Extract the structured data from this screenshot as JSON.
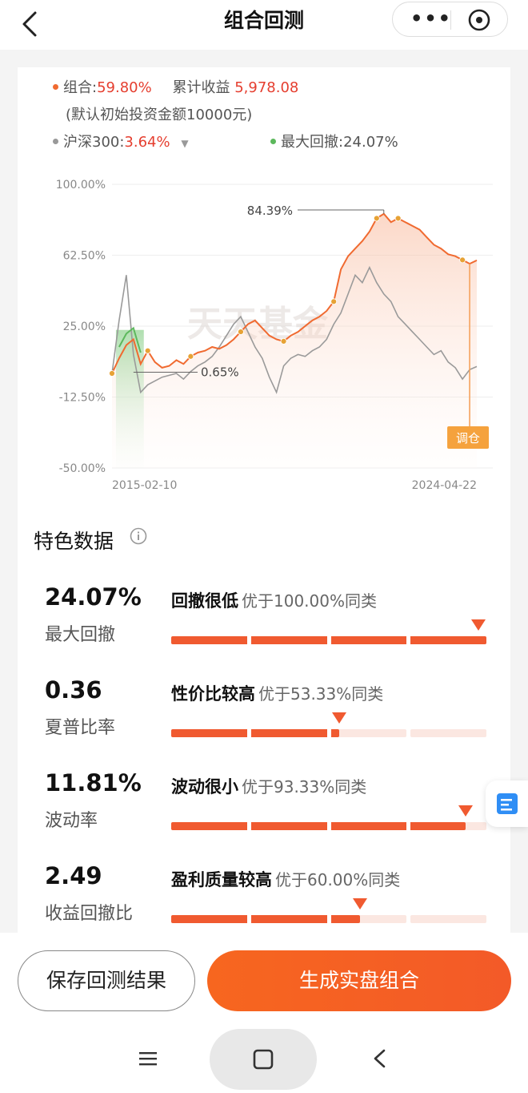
{
  "header": {
    "title": "组合回测",
    "more_icon": "more-dots-icon",
    "close_icon": "close-circle-icon"
  },
  "legend": {
    "portfolio_label": "组合:",
    "portfolio_value": "59.80%",
    "cumulative_label": "累计收益",
    "cumulative_value": "5,978.08",
    "note": "(默认初始投资金额10000元)",
    "benchmark_label": "沪深300:",
    "benchmark_value": "3.64%",
    "drawdown_label": "最大回撤:",
    "drawdown_value": "24.07%"
  },
  "colors": {
    "portfolio": "#f06a30",
    "benchmark": "#999999",
    "drawdown": "#5cb85c",
    "accent": "#f35a28"
  },
  "chart_data": {
    "type": "line",
    "ylim": [
      -50,
      100
    ],
    "yticks": [
      "100.00%",
      "62.50%",
      "25.00%",
      "-12.50%",
      "-50.00%"
    ],
    "x_start": "2015-02-10",
    "x_end": "2024-04-22",
    "annotations": {
      "peak": "84.39%",
      "trough": "0.65%",
      "rebalance": "调仓"
    },
    "watermark": "天天基金",
    "series": [
      {
        "name": "组合",
        "values": [
          0,
          8,
          15,
          18,
          5,
          12,
          6,
          3,
          4,
          7,
          5,
          9,
          11,
          12,
          14,
          13,
          15,
          18,
          22,
          26,
          28,
          24,
          20,
          18,
          17,
          20,
          22,
          25,
          28,
          30,
          33,
          38,
          55,
          62,
          66,
          70,
          75,
          82,
          84.39,
          80,
          82,
          80,
          78,
          76,
          72,
          68,
          66,
          63,
          62,
          60,
          58,
          59.8
        ]
      },
      {
        "name": "沪深300",
        "values": [
          0,
          28,
          52,
          10,
          -10,
          -6,
          -4,
          -2,
          -1,
          0,
          -3,
          1,
          4,
          6,
          9,
          14,
          20,
          26,
          30,
          22,
          14,
          8,
          -2,
          -10,
          4,
          8,
          10,
          9,
          12,
          14,
          18,
          26,
          32,
          42,
          52,
          48,
          56,
          48,
          42,
          38,
          30,
          26,
          22,
          18,
          14,
          10,
          12,
          6,
          3,
          -3,
          2,
          3.64
        ]
      }
    ]
  },
  "features": {
    "title": "特色数据",
    "items": [
      {
        "value": "24.07%",
        "label": "最大回撤",
        "rating": "回撤很低",
        "desc": "优于100.00%同类",
        "pct": 100
      },
      {
        "value": "0.36",
        "label": "夏普比率",
        "rating": "性价比较高",
        "desc": "优于53.33%同类",
        "pct": 53.33
      },
      {
        "value": "11.81%",
        "label": "波动率",
        "rating": "波动很小",
        "desc": "优于93.33%同类",
        "pct": 93.33
      },
      {
        "value": "2.49",
        "label": "收益回撤比",
        "rating": "盈利质量较高",
        "desc": "优于60.00%同类",
        "pct": 60
      }
    ]
  },
  "buttons": {
    "save": "保存回测结果",
    "generate": "生成实盘组合"
  }
}
